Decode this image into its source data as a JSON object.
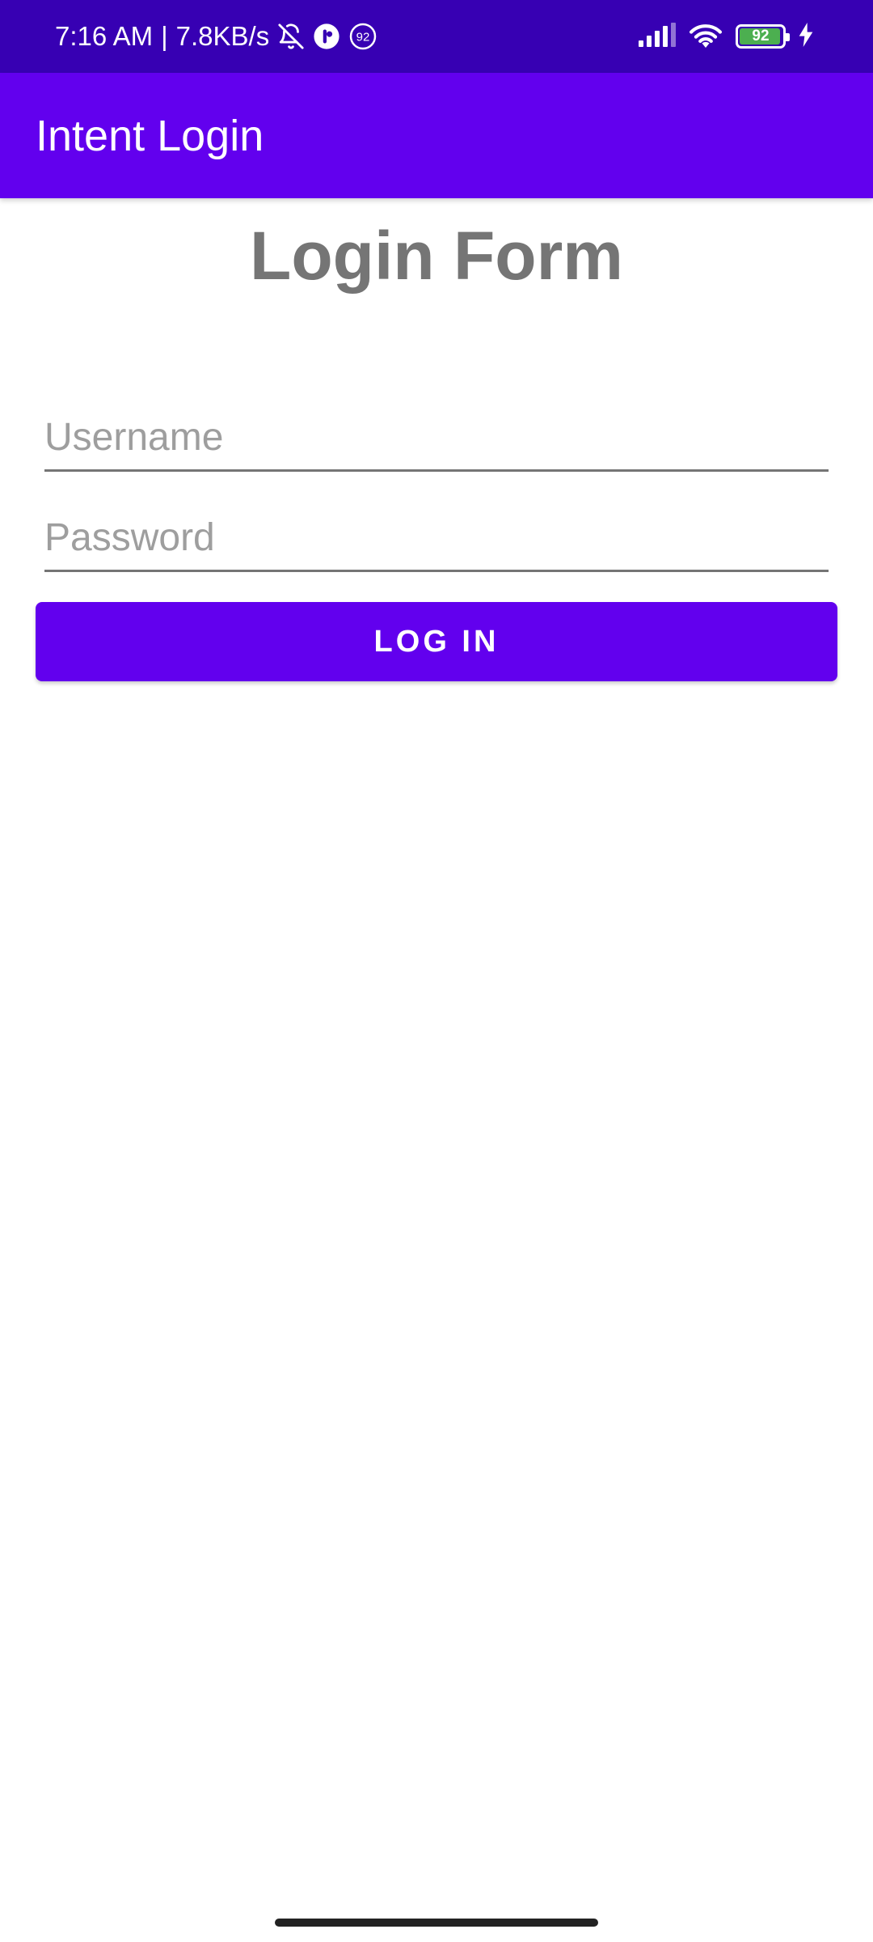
{
  "status_bar": {
    "time": "7:16 AM",
    "separator": "|",
    "network_speed": "7.8KB/s",
    "notification_count": "92",
    "battery_level": "92",
    "icons": [
      "bell-off-icon",
      "app-notification-icon",
      "badge-92-icon",
      "signal-icon",
      "wifi-icon",
      "battery-icon",
      "charging-icon"
    ]
  },
  "app_bar": {
    "title": "Intent Login",
    "color": "#6200EE"
  },
  "form": {
    "title": "Login Form",
    "username": {
      "placeholder": "Username",
      "value": ""
    },
    "password": {
      "placeholder": "Password",
      "value": ""
    },
    "login_label": "LOG IN"
  },
  "colors": {
    "status_bar": "#3700B3",
    "primary": "#6200EE",
    "title_text": "#757575",
    "placeholder": "#9e9e9e"
  }
}
